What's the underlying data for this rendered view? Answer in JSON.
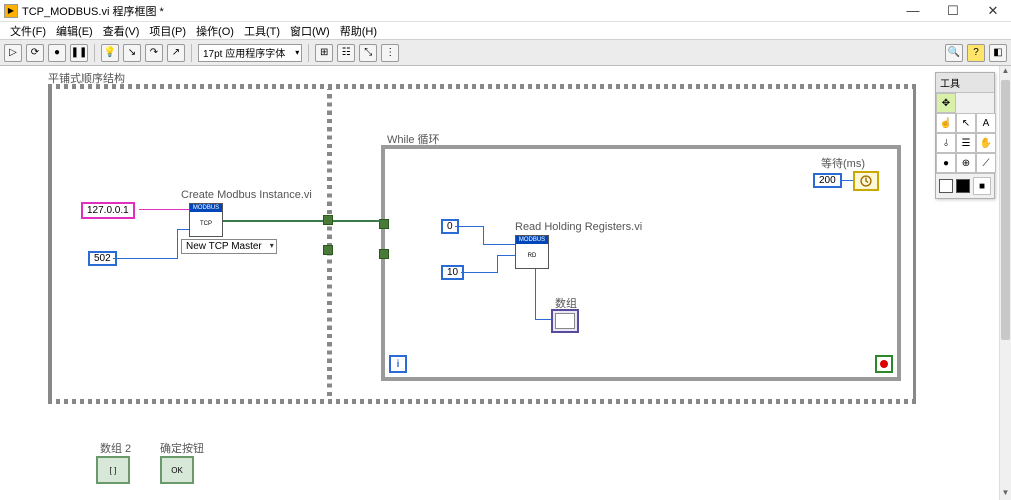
{
  "titlebar": {
    "icon_label": "▶",
    "title": "TCP_MODBUS.vi 程序框图 *"
  },
  "window_buttons": {
    "min": "—",
    "max": "☐",
    "close": "✕"
  },
  "menu": {
    "file": "文件(F)",
    "edit": "编辑(E)",
    "view": "查看(V)",
    "project": "项目(P)",
    "operate": "操作(O)",
    "tools": "工具(T)",
    "window": "窗口(W)",
    "help": "帮助(H)"
  },
  "toolbar": {
    "run": "▷",
    "run_cont": "⟳",
    "abort": "●",
    "pause": "❚❚",
    "highlight": "💡",
    "step_into": "↘",
    "step_over": "↷",
    "step_out": "↗",
    "font_label": "17pt 应用程序字体",
    "align": "⊞",
    "distribute": "☷",
    "resize": "⤡",
    "reorder": "⋮",
    "search": "🔍",
    "help": "?",
    " ctx": "◧"
  },
  "structures": {
    "flat_sequence_label": "平铺式顺序结构",
    "while_label": "While 循环"
  },
  "frame1": {
    "create_modbus_label": "Create Modbus Instance.vi",
    "ip_constant": "127.0.0.1",
    "port_constant": "502",
    "polyselector": "New TCP Master",
    "node_header": "MODBUS"
  },
  "frame2": {
    "read_label": "Read Holding Registers.vi",
    "addr_constant": "0",
    "qty_constant": "10",
    "array_label": "数组",
    "wait_label": "等待(ms)",
    "wait_value": "200",
    "node_header": "MODBUS"
  },
  "bottom_controls": {
    "array2_label": "数组 2",
    "ok_button_label": "确定按钮",
    "ok_text": "OK"
  },
  "tools_palette": {
    "title": "工具",
    "auto": "✥",
    "operate": "☝",
    "position": "↖",
    "text": "A",
    "wire": "⫰",
    "popup": "☰",
    "scroll": "✋",
    "breakpoint": "●",
    "probe": "⊕",
    "getcolor": "⟋",
    "color": "■"
  }
}
